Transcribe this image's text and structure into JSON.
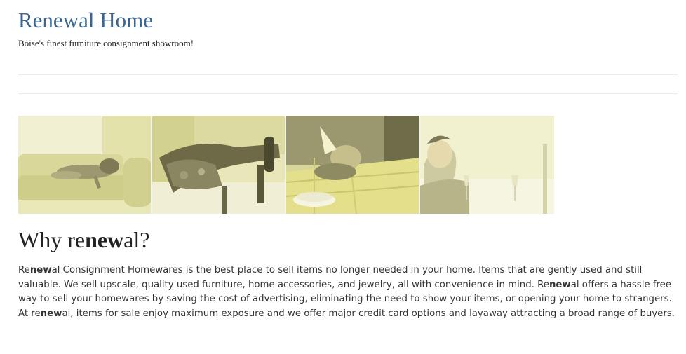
{
  "header": {
    "title": "Renewal Home",
    "tagline": "Boise's finest furniture consignment showroom!"
  },
  "photos": [
    {
      "icon": "dog-on-sofa-photo"
    },
    {
      "icon": "feet-on-table-photo"
    },
    {
      "icon": "child-asleep-at-table-photo"
    },
    {
      "icon": "woman-with-wine-glasses-photo"
    }
  ],
  "section": {
    "heading_pre": "Why re",
    "heading_bold": "new",
    "heading_post": "al?"
  },
  "paragraph": {
    "s1_pre": "Re",
    "s1_bold": "new",
    "s1_post": "al Consignment Homewares is the best place to sell items no longer needed in your home. Items that are gently used and still valuable. We sell upscale, quality used furniture, home accessories, and jewelry, all with convenience in mind. Re",
    "s2_bold": "new",
    "s2_post": "al offers a hassle free way to sell your homewares by saving the cost of advertising, eliminating the need to show your items, or opening your home to strangers. At re",
    "s3_bold": "new",
    "s3_post": "al, items for sale enjoy maximum exposure and we offer major credit card options and layaway attracting a broad range of buyers."
  },
  "colors": {
    "title": "#3a6691",
    "photo_tint": "#e6e6a8",
    "rule": "#ececec"
  }
}
